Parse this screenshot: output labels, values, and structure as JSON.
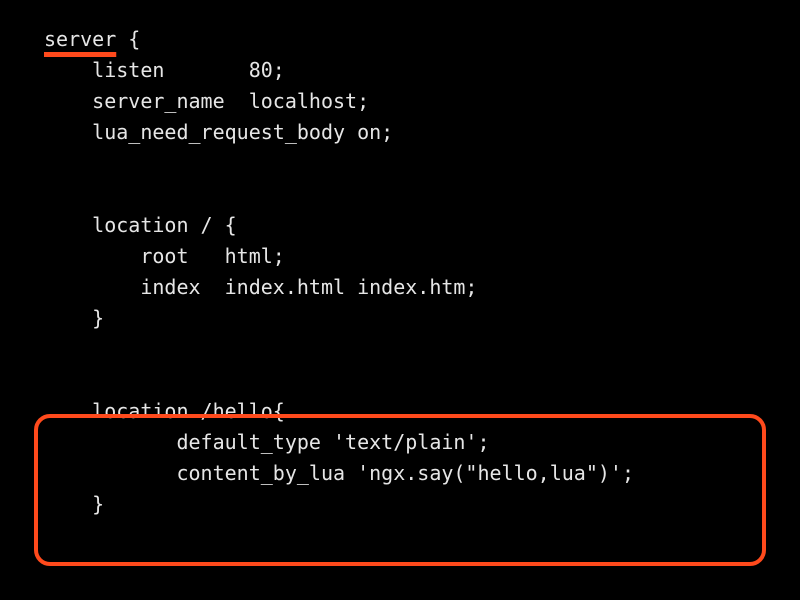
{
  "code": {
    "l1a": "server",
    "l1b": " {",
    "l2": "    listen       80;",
    "l3": "    server_name  localhost;",
    "l4": "    lua_need_request_body on;",
    "l5": "",
    "l6": "",
    "l7": "    location / {",
    "l8": "        root   html;",
    "l9": "        index  index.html index.htm;",
    "l10": "    }",
    "l11": "",
    "l12": "",
    "l13": "    location /hello{",
    "l14": "           default_type 'text/plain';",
    "l15": "           content_by_lua 'ngx.say(\"hello,lua\")';",
    "l16": "    }"
  }
}
